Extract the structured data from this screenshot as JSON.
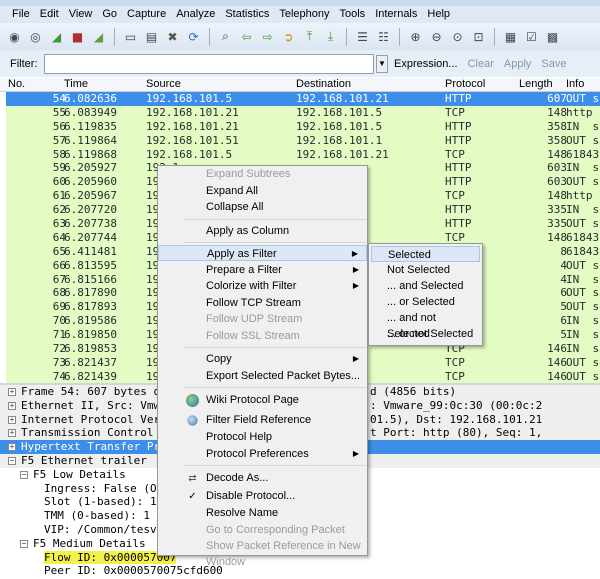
{
  "menubar": [
    "File",
    "Edit",
    "View",
    "Go",
    "Capture",
    "Analyze",
    "Statistics",
    "Telephony",
    "Tools",
    "Internals",
    "Help"
  ],
  "toolbar_icons": [
    "interface-list-icon",
    "capture-options-icon",
    "start-capture-icon",
    "stop-capture-icon",
    "restart-capture-icon",
    "open-file-icon",
    "save-file-icon",
    "close-file-icon",
    "reload-icon",
    "find-packet-icon",
    "go-back-icon",
    "go-forward-icon",
    "go-to-packet-icon",
    "go-first-icon",
    "go-last-icon",
    "colorize-icon",
    "auto-scroll-icon",
    "zoom-in-icon",
    "zoom-out-icon",
    "zoom-normal-icon",
    "resize-columns-icon",
    "capture-filters-icon",
    "display-filters-icon",
    "coloring-rules-icon"
  ],
  "filter": {
    "label": "Filter:",
    "value": "",
    "expression": "Expression...",
    "clear": "Clear",
    "apply": "Apply",
    "save": "Save"
  },
  "columns": [
    "No.",
    "Time",
    "Source",
    "Destination",
    "Protocol",
    "Length",
    "Info"
  ],
  "rows": [
    [
      "54",
      "6.082636",
      "192.168.101.5",
      "192.168.101.21",
      "HTTP",
      "607",
      "OUT s"
    ],
    [
      "55",
      "6.083949",
      "192.168.101.21",
      "192.168.101.5",
      "TCP",
      "148",
      "http"
    ],
    [
      "56",
      "6.119835",
      "192.168.101.21",
      "192.168.101.5",
      "HTTP",
      "358",
      "IN  s"
    ],
    [
      "57",
      "6.119864",
      "192.168.101.51",
      "192.168.101.1",
      "HTTP",
      "358",
      "OUT s"
    ],
    [
      "58",
      "6.119868",
      "192.168.101.5",
      "192.168.101.21",
      "TCP",
      "148",
      "61843"
    ],
    [
      "59",
      "6.205927",
      "192.1",
      "",
      "HTTP",
      "603",
      "IN  s"
    ],
    [
      "60",
      "6.205960",
      "192.1",
      "",
      "HTTP",
      "603",
      "OUT s"
    ],
    [
      "61",
      "6.205967",
      "192.1",
      "",
      "TCP",
      "148",
      "http"
    ],
    [
      "62",
      "6.207720",
      "192.1",
      "",
      "HTTP",
      "335",
      "IN  s"
    ],
    [
      "63",
      "6.207738",
      "192.1",
      "",
      "HTTP",
      "335",
      "OUT s"
    ],
    [
      "64",
      "6.207744",
      "192.1",
      "",
      "TCP",
      "148",
      "61843"
    ],
    [
      "65",
      "6.411481",
      "192.1",
      "",
      "",
      "8",
      "61843"
    ],
    [
      "66",
      "6.813595",
      "192.1",
      "",
      "",
      "4",
      "OUT s"
    ],
    [
      "67",
      "6.815166",
      "192.1",
      "",
      "",
      "4",
      "IN  s"
    ],
    [
      "68",
      "6.817890",
      "192.1",
      "",
      "",
      "6",
      "OUT s"
    ],
    [
      "69",
      "6.817893",
      "192.1",
      "",
      "",
      "5",
      "OUT s"
    ],
    [
      "70",
      "6.819586",
      "192.1",
      "",
      "",
      "6",
      "IN  s"
    ],
    [
      "71",
      "6.819850",
      "192.1",
      "",
      "",
      "5",
      "IN  s"
    ],
    [
      "72",
      "6.819853",
      "192.1",
      "",
      "TCP",
      "146",
      "IN  s"
    ],
    [
      "73",
      "6.821437",
      "192.1",
      "",
      "TCP",
      "146",
      "OUT s"
    ],
    [
      "74",
      "6.821439",
      "192.1",
      "",
      "TCP",
      "146",
      "OUT s"
    ]
  ],
  "selected_row": "54",
  "detail": [
    {
      "exp": "+",
      "indent": 0,
      "text": "Frame 54: 607 bytes on",
      "right": "d (4856 bits)",
      "style": "gray"
    },
    {
      "exp": "+",
      "indent": 0,
      "text": "Ethernet II, Src: Vmwar",
      "right": ": Vmware_99:0c:30 (00:0c:2",
      "style": "gray"
    },
    {
      "exp": "+",
      "indent": 0,
      "text": "Internet Protocol Versi",
      "right": "01.5), Dst: 192.168.101.21",
      "style": "gray"
    },
    {
      "exp": "+",
      "indent": 0,
      "text": "Transmission Control Pr",
      "right": "t Port: http (80), Seq: 1,",
      "style": "gray"
    },
    {
      "exp": "+",
      "indent": 0,
      "text": "Hypertext Transfer Prot",
      "right": "",
      "style": "hl"
    },
    {
      "exp": "-",
      "indent": 0,
      "text": "F5 Ethernet trailer",
      "right": "",
      "style": "gray"
    },
    {
      "exp": "-",
      "indent": 1,
      "text": "F5 Low Details",
      "right": "",
      "style": ""
    },
    {
      "exp": "",
      "indent": 2,
      "text": "Ingress: False (OUT",
      "right": "",
      "style": ""
    },
    {
      "exp": "",
      "indent": 2,
      "text": "Slot (1-based): 1",
      "right": "",
      "style": ""
    },
    {
      "exp": "",
      "indent": 2,
      "text": "TMM (0-based): 1",
      "right": "",
      "style": ""
    },
    {
      "exp": "",
      "indent": 2,
      "text": "VIP: /Common/tesvip",
      "right": "",
      "style": ""
    },
    {
      "exp": "-",
      "indent": 1,
      "text": "F5 Medium Details",
      "right": "",
      "style": ""
    },
    {
      "exp": "",
      "indent": 2,
      "text": "Flow ID: 0x000057007",
      "right": "",
      "style": "yellow"
    },
    {
      "exp": "",
      "indent": 2,
      "text": "Peer ID: 0x0000570075cfd600",
      "right": "",
      "style": ""
    }
  ],
  "context_menu": {
    "expand_subtrees": "Expand Subtrees",
    "expand_all": "Expand All",
    "collapse_all": "Collapse All",
    "apply_as_column": "Apply as Column",
    "apply_as_filter": "Apply as Filter",
    "prepare_filter": "Prepare a Filter",
    "colorize": "Colorize with Filter",
    "follow_tcp": "Follow TCP Stream",
    "follow_udp": "Follow UDP Stream",
    "follow_ssl": "Follow SSL Stream",
    "copy": "Copy",
    "export_bytes": "Export Selected Packet Bytes...",
    "wiki": "Wiki Protocol Page",
    "filter_ref": "Filter Field Reference",
    "protocol_help": "Protocol Help",
    "protocol_prefs": "Protocol Preferences",
    "decode_as": "Decode As...",
    "disable_protocol": "Disable Protocol...",
    "resolve_name": "Resolve Name",
    "goto_corresponding": "Go to Corresponding Packet",
    "show_reference": "Show Packet Reference in New Window"
  },
  "submenu": [
    "Selected",
    "Not Selected",
    "... and Selected",
    "... or Selected",
    "... and not Selected",
    "... or not Selected"
  ],
  "colors": {
    "row_bg": "#e2fcc4",
    "selected": "#3d8ee8",
    "highlight": "#f3f24a",
    "menu_bg": "#f0f0f0"
  }
}
